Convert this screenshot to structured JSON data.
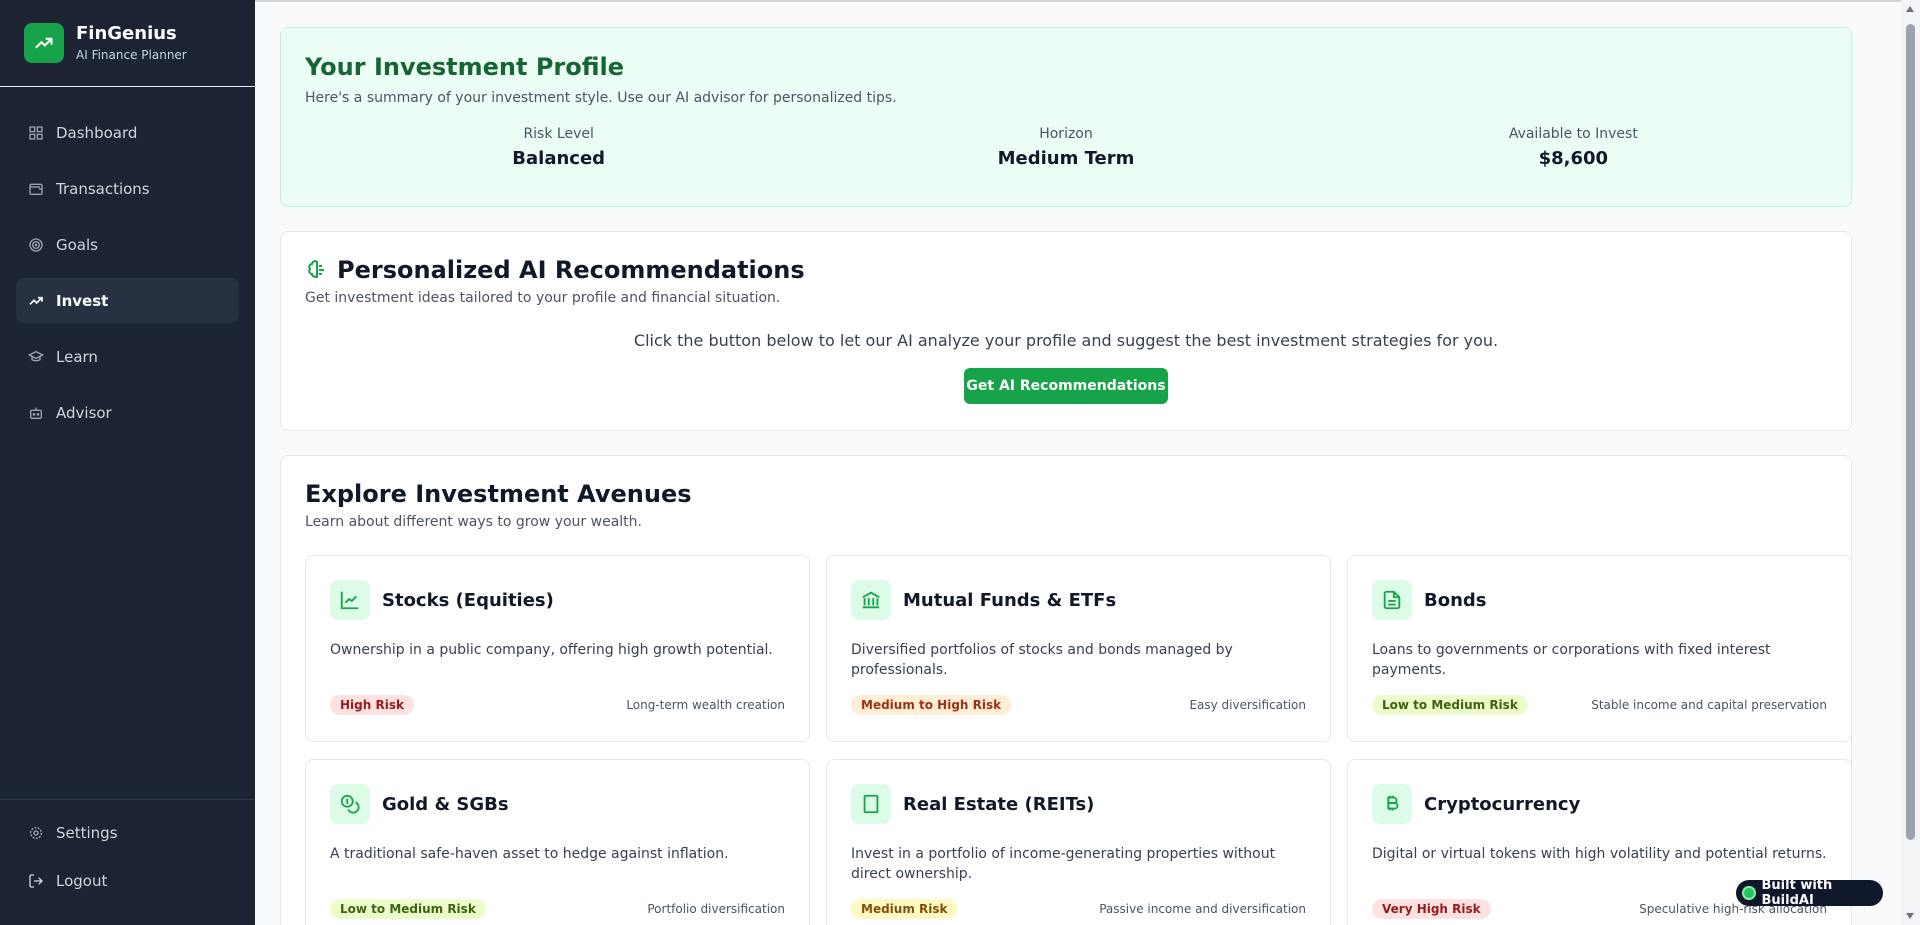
{
  "brand": {
    "name": "FinGenius",
    "subtitle": "AI Finance Planner"
  },
  "nav": [
    {
      "label": "Dashboard",
      "icon": "grid-icon",
      "active": false
    },
    {
      "label": "Transactions",
      "icon": "wallet-icon",
      "active": false
    },
    {
      "label": "Goals",
      "icon": "target-icon",
      "active": false
    },
    {
      "label": "Invest",
      "icon": "trending-up-icon",
      "active": true
    },
    {
      "label": "Learn",
      "icon": "graduation-cap-icon",
      "active": false
    },
    {
      "label": "Advisor",
      "icon": "bot-icon",
      "active": false
    }
  ],
  "sidebar_bottom": {
    "settings": "Settings",
    "logout": "Logout"
  },
  "profile": {
    "title": "Your Investment Profile",
    "subtitle": "Here's a summary of your investment style. Use our AI advisor for personalized tips.",
    "stats": [
      {
        "label": "Risk Level",
        "value": "Balanced"
      },
      {
        "label": "Horizon",
        "value": "Medium Term"
      },
      {
        "label": "Available to Invest",
        "value": "$8,600"
      }
    ]
  },
  "recommendations": {
    "title": "Personalized AI Recommendations",
    "subtitle": "Get investment ideas tailored to your profile and financial situation.",
    "prompt": "Click the button below to let our AI analyze your profile and suggest the best investment strategies for you.",
    "button": "Get AI Recommendations"
  },
  "avenues": {
    "title": "Explore Investment Avenues",
    "subtitle": "Learn about different ways to grow your wealth.",
    "items": [
      {
        "name": "Stocks (Equities)",
        "icon": "chart-icon",
        "desc": "Ownership in a public company, offering high growth potential.",
        "risk": "High Risk",
        "note": "Long-term wealth creation"
      },
      {
        "name": "Mutual Funds & ETFs",
        "icon": "landmark-icon",
        "desc": "Diversified portfolios of stocks and bonds managed by professionals.",
        "risk": "Medium to High Risk",
        "note": "Easy diversification"
      },
      {
        "name": "Bonds",
        "icon": "document-icon",
        "desc": "Loans to governments or corporations with fixed interest payments.",
        "risk": "Low to Medium Risk",
        "note": "Stable income and capital preservation"
      },
      {
        "name": "Gold & SGBs",
        "icon": "coins-icon",
        "desc": "A traditional safe-haven asset to hedge against inflation.",
        "risk": "Low to Medium Risk",
        "note": "Portfolio diversification"
      },
      {
        "name": "Real Estate (REITs)",
        "icon": "building-icon",
        "desc": "Invest in a portfolio of income-generating properties without direct ownership.",
        "risk": "Medium Risk",
        "note": "Passive income and diversification"
      },
      {
        "name": "Cryptocurrency",
        "icon": "bitcoin-icon",
        "desc": "Digital or virtual tokens with high volatility and potential returns.",
        "risk": "Very High Risk",
        "note": "Speculative high-risk allocation"
      }
    ]
  },
  "built_with": "Built with BuildAI",
  "colors": {
    "accent": "#16a34a",
    "sidebar": "#1c2433",
    "profile_bg": "#ecfdf5"
  }
}
